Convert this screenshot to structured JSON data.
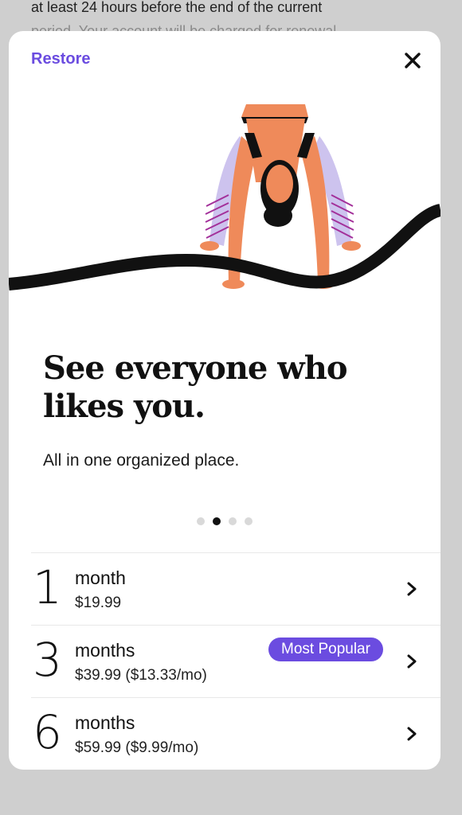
{
  "background_text": {
    "line1": "at least 24 hours before the end of the current",
    "line2": "period. Your account will be charged for renewal"
  },
  "header": {
    "restore_label": "Restore",
    "close_icon": "close-icon"
  },
  "hero": {
    "title_line1": "See everyone who",
    "title_line2": "likes you.",
    "subtitle": "All in one organized place."
  },
  "carousel": {
    "count": 4,
    "active_index": 1
  },
  "plans": [
    {
      "number": "1",
      "unit": "month",
      "price": "$19.99",
      "badge": ""
    },
    {
      "number": "3",
      "unit": "months",
      "price": "$39.99 ($13.33/mo)",
      "badge": "Most Popular"
    },
    {
      "number": "6",
      "unit": "months",
      "price": "$59.99 ($9.99/mo)",
      "badge": ""
    }
  ],
  "colors": {
    "accent": "#6b4ce0",
    "skin": "#ef8a5a",
    "sleeve": "#cdc3ee",
    "wave": "#111111"
  }
}
